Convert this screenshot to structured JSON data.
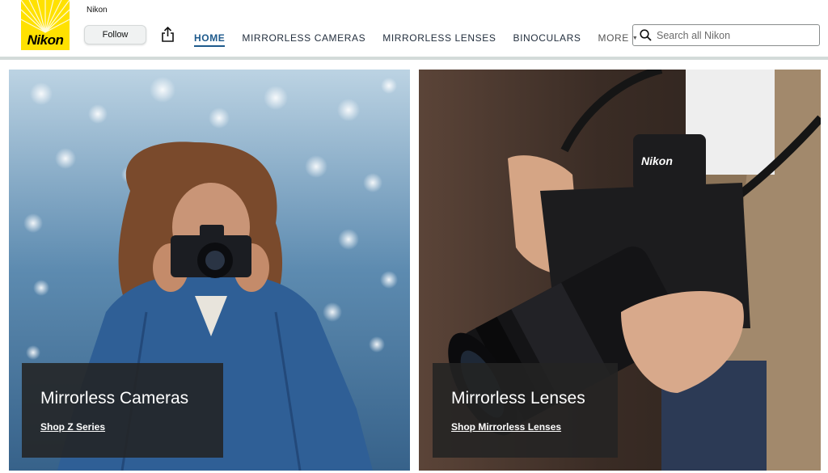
{
  "brand": {
    "logo_text": "Nikon",
    "name": "Nikon",
    "follow_label": "Follow"
  },
  "nav": {
    "items": [
      {
        "label": "HOME",
        "active": true
      },
      {
        "label": "MIRRORLESS CAMERAS"
      },
      {
        "label": "MIRRORLESS LENSES"
      },
      {
        "label": "BINOCULARS"
      }
    ],
    "more_label": "MORE"
  },
  "search": {
    "placeholder": "Search all Nikon"
  },
  "tiles": [
    {
      "title": "Mirrorless Cameras",
      "link": "Shop Z Series"
    },
    {
      "title": "Mirrorless Lenses",
      "link": "Shop Mirrorless Lenses"
    }
  ],
  "colors": {
    "logo_yellow": "#ffe100",
    "nav_active": "#1e5a8c",
    "divider": "#d3dbd9",
    "caption_bg": "#232323"
  }
}
